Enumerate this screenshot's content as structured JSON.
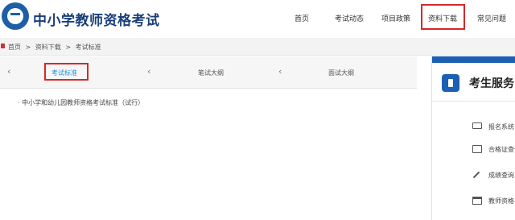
{
  "header": {
    "brand": "中小学教师资格考试",
    "nav": [
      {
        "label": "首页"
      },
      {
        "label": "考试动态"
      },
      {
        "label": "项目政策"
      },
      {
        "label": "资料下载"
      },
      {
        "label": "常见问题"
      }
    ]
  },
  "breadcrumb": [
    "首页",
    ">",
    "资料下载",
    ">",
    "考试标准"
  ],
  "tabs": {
    "left_chevron": "‹",
    "items": [
      {
        "label": "考试标准"
      },
      {
        "label": "笔试大纲"
      },
      {
        "label": "面试大纲"
      }
    ]
  },
  "list": [
    {
      "text": "· 中小学和幼儿园教师资格考试标准（试行）"
    }
  ],
  "sidebar": {
    "title": "考生服务",
    "items": [
      {
        "label": "报名系统",
        "icon": "monitor-icon"
      },
      {
        "label": "合格证查询",
        "icon": "card-icon"
      },
      {
        "label": "成绩查询",
        "icon": "pencil-icon"
      },
      {
        "label": "教师资格",
        "icon": "calendar-icon"
      }
    ]
  },
  "colors": {
    "brand": "#1a3f7a",
    "accent": "#1c5fb3",
    "highlight": "#d9262a",
    "active_tab": "#1b8fd6"
  }
}
